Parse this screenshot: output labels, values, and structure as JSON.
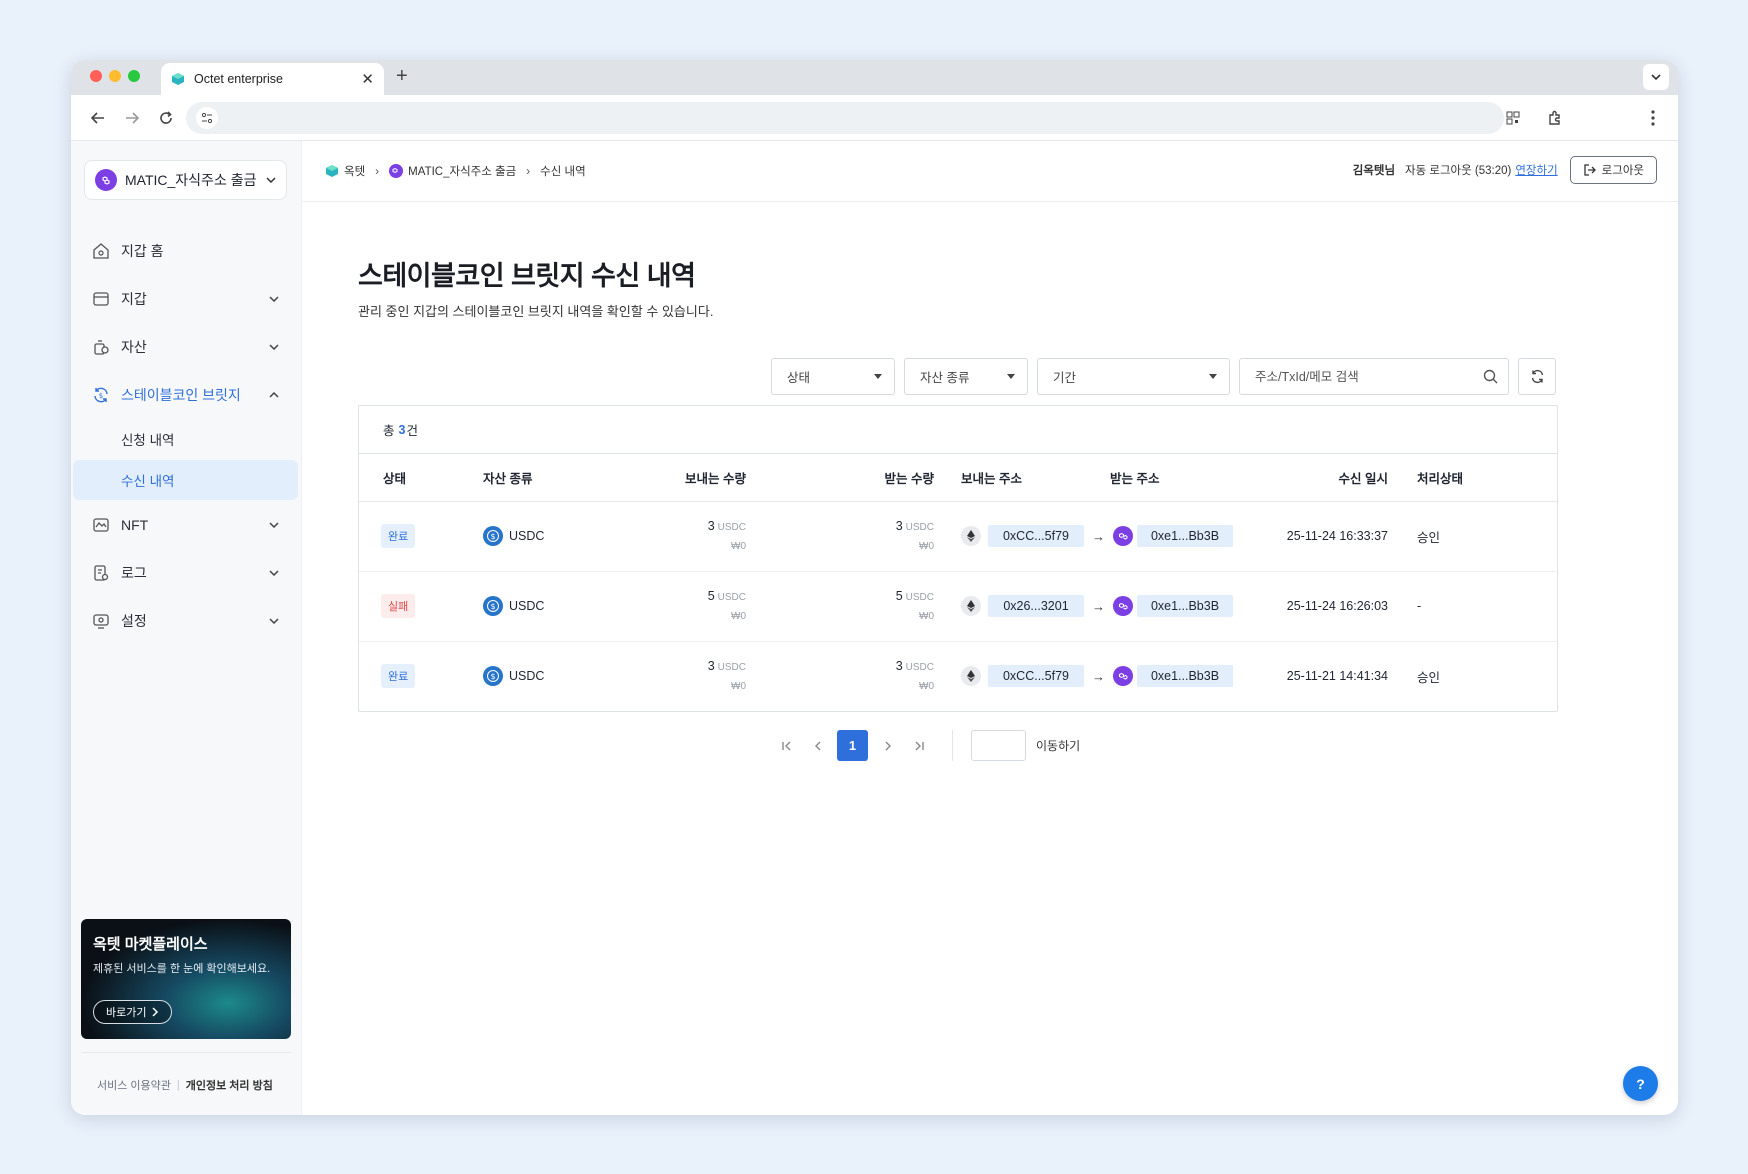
{
  "browser": {
    "tab_title": "Octet enterprise",
    "new_tab": "+",
    "close": "✕"
  },
  "sidebar": {
    "wallet_label": "MATIC_자식주소 출금",
    "items": [
      {
        "label": "지갑 홈"
      },
      {
        "label": "지갑"
      },
      {
        "label": "자산"
      },
      {
        "label": "스테이블코인 브릿지"
      },
      {
        "label": "NFT"
      },
      {
        "label": "로그"
      },
      {
        "label": "설정"
      }
    ],
    "sub_items": [
      {
        "label": "신청 내역"
      },
      {
        "label": "수신 내역"
      }
    ],
    "promo": {
      "title": "옥텟 마켓플레이스",
      "subtitle": "제휴된 서비스를 한 눈에 확인해보세요.",
      "button": "바로가기"
    },
    "footer": {
      "terms": "서비스 이용약관",
      "privacy": "개인정보 처리 방침"
    }
  },
  "topbar": {
    "breadcrumb": [
      "옥텟",
      "MATIC_자식주소 출금",
      "수신 내역"
    ],
    "user": "김옥텟님",
    "auto_logout": "자동 로그아웃 (53:20)",
    "extend": "연장하기",
    "logout": "로그아웃"
  },
  "page": {
    "title": "스테이블코인 브릿지 수신 내역",
    "description": "관리 중인 지갑의 스테이블코인 브릿지 내역을 확인할 수 있습니다."
  },
  "filters": {
    "status": "상태",
    "asset_type": "자산 종류",
    "period": "기간",
    "search_placeholder": "주소/TxId/메모 검색"
  },
  "table": {
    "total_prefix": "총",
    "total_count": "3",
    "total_suffix": "건",
    "columns": [
      "상태",
      "자산 종류",
      "보내는 수량",
      "받는 수량",
      "보내는 주소",
      "받는 주소",
      "수신 일시",
      "처리상태"
    ],
    "rows": [
      {
        "status": "완료",
        "status_type": "ok",
        "asset": "USDC",
        "send_amount": "3",
        "send_unit": "USDC",
        "send_won": "₩0",
        "recv_amount": "3",
        "recv_unit": "USDC",
        "recv_won": "₩0",
        "from": "0xCC...5f79",
        "to": "0xe1...Bb3B",
        "date": "25-11-24 16:33:37",
        "result": "승인"
      },
      {
        "status": "실패",
        "status_type": "fail",
        "asset": "USDC",
        "send_amount": "5",
        "send_unit": "USDC",
        "send_won": "₩0",
        "recv_amount": "5",
        "recv_unit": "USDC",
        "recv_won": "₩0",
        "from": "0x26...3201",
        "to": "0xe1...Bb3B",
        "date": "25-11-24 16:26:03",
        "result": "-"
      },
      {
        "status": "완료",
        "status_type": "ok",
        "asset": "USDC",
        "send_amount": "3",
        "send_unit": "USDC",
        "send_won": "₩0",
        "recv_amount": "3",
        "recv_unit": "USDC",
        "recv_won": "₩0",
        "from": "0xCC...5f79",
        "to": "0xe1...Bb3B",
        "date": "25-11-21 14:41:34",
        "result": "승인"
      }
    ]
  },
  "pager": {
    "current": "1",
    "go_label": "이동하기"
  },
  "help": "?",
  "colors": {
    "accent": "#2f6fdb",
    "fail": "#e04848",
    "polygon": "#7b3fe4",
    "usdc": "#2775ca"
  }
}
